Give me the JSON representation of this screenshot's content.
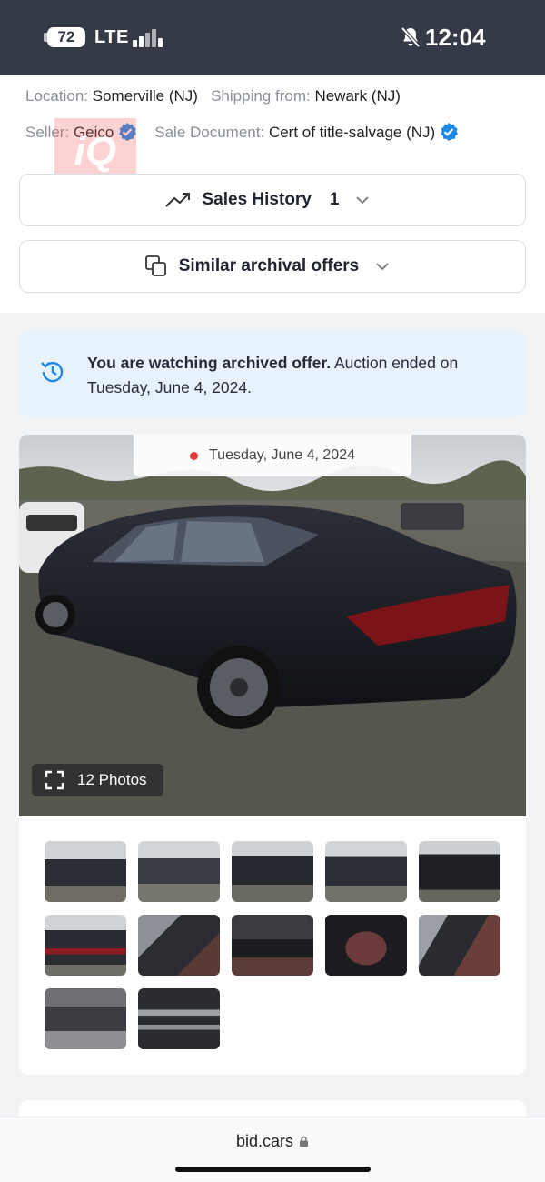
{
  "status_bar": {
    "battery": "72",
    "network": "LTE",
    "time": "12:04"
  },
  "details": {
    "location_label": "Location:",
    "location_value": "Somerville (NJ)",
    "shipping_label": "Shipping from:",
    "shipping_value": "Newark (NJ)",
    "seller_label": "Seller:",
    "seller_value": "Geico",
    "document_label": "Sale Document:",
    "document_value": "Cert of title-salvage (NJ)"
  },
  "sales_history": {
    "label": "Sales History",
    "count": "1"
  },
  "similar_offers": {
    "label": "Similar archival offers"
  },
  "notice": {
    "bold": "You are watching archived offer.",
    "text": " Auction ended on Tuesday, June 4, 2024."
  },
  "gallery": {
    "date": "Tuesday, June 4, 2024",
    "photos_label": "12 Photos",
    "thumbnail_count": 12
  },
  "browser": {
    "url": "bid.cars"
  },
  "colors": {
    "status_bar": "#343b47",
    "accent_blue": "#1e88e5",
    "notice_bg": "#e7f2fb",
    "red_dot": "#e53935"
  }
}
